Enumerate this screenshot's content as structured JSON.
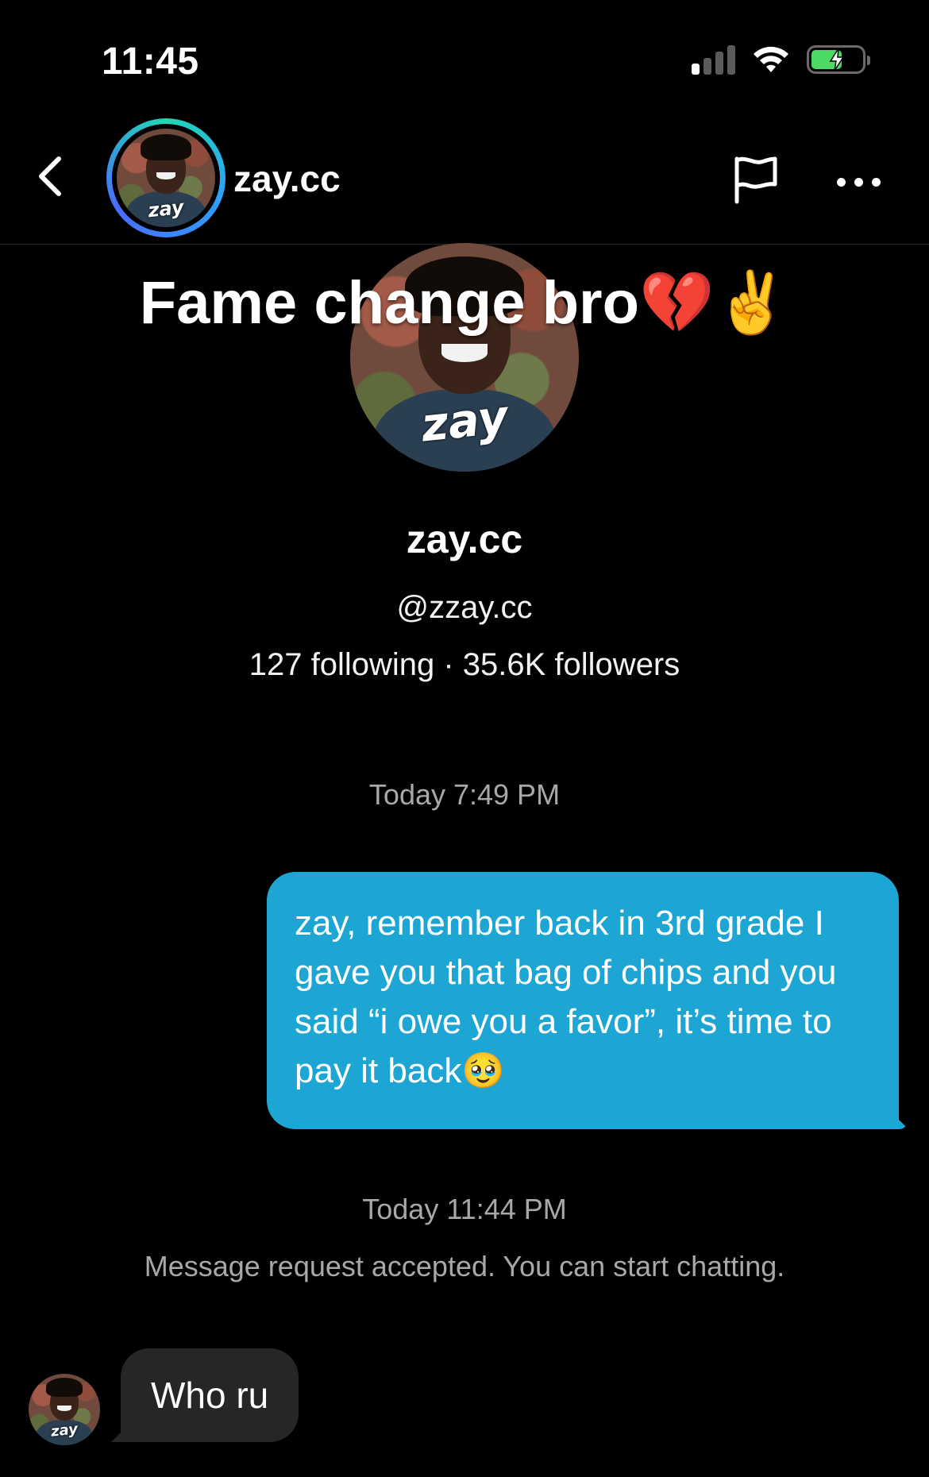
{
  "status_bar": {
    "time": "11:45",
    "icons": [
      "signal-icon",
      "wifi-icon",
      "battery-charging-icon"
    ]
  },
  "header": {
    "back_icon": "chevron-left-icon",
    "username": "zay.cc",
    "avatar_caption": "zay",
    "flag_icon": "flag-icon",
    "more_icon": "more-horizontal-icon",
    "ring_colors": [
      "#1fd8b3",
      "#2d9cff",
      "#4b6bff"
    ]
  },
  "profile": {
    "overlay_text": "Fame change bro💔✌️",
    "avatar_caption": "zay",
    "name": "zay.cc",
    "handle": "@zzay.cc",
    "stats": "127 following · 35.6K followers"
  },
  "messages": {
    "timestamp_1": "Today 7:49 PM",
    "sent_text": "zay, remember back in 3rd grade I gave you that bag of chips and you said “i owe you a favor”, it’s time to pay it back🥹",
    "timestamp_2": "Today 11:44 PM",
    "system_note": "Message request accepted. You can start chatting.",
    "received_avatar_caption": "zay",
    "received_text": "Who ru"
  },
  "colors": {
    "sent_bubble": "#1da6d4",
    "received_bubble": "#262626",
    "background": "#000000",
    "muted_text": "#a8a8a8"
  }
}
